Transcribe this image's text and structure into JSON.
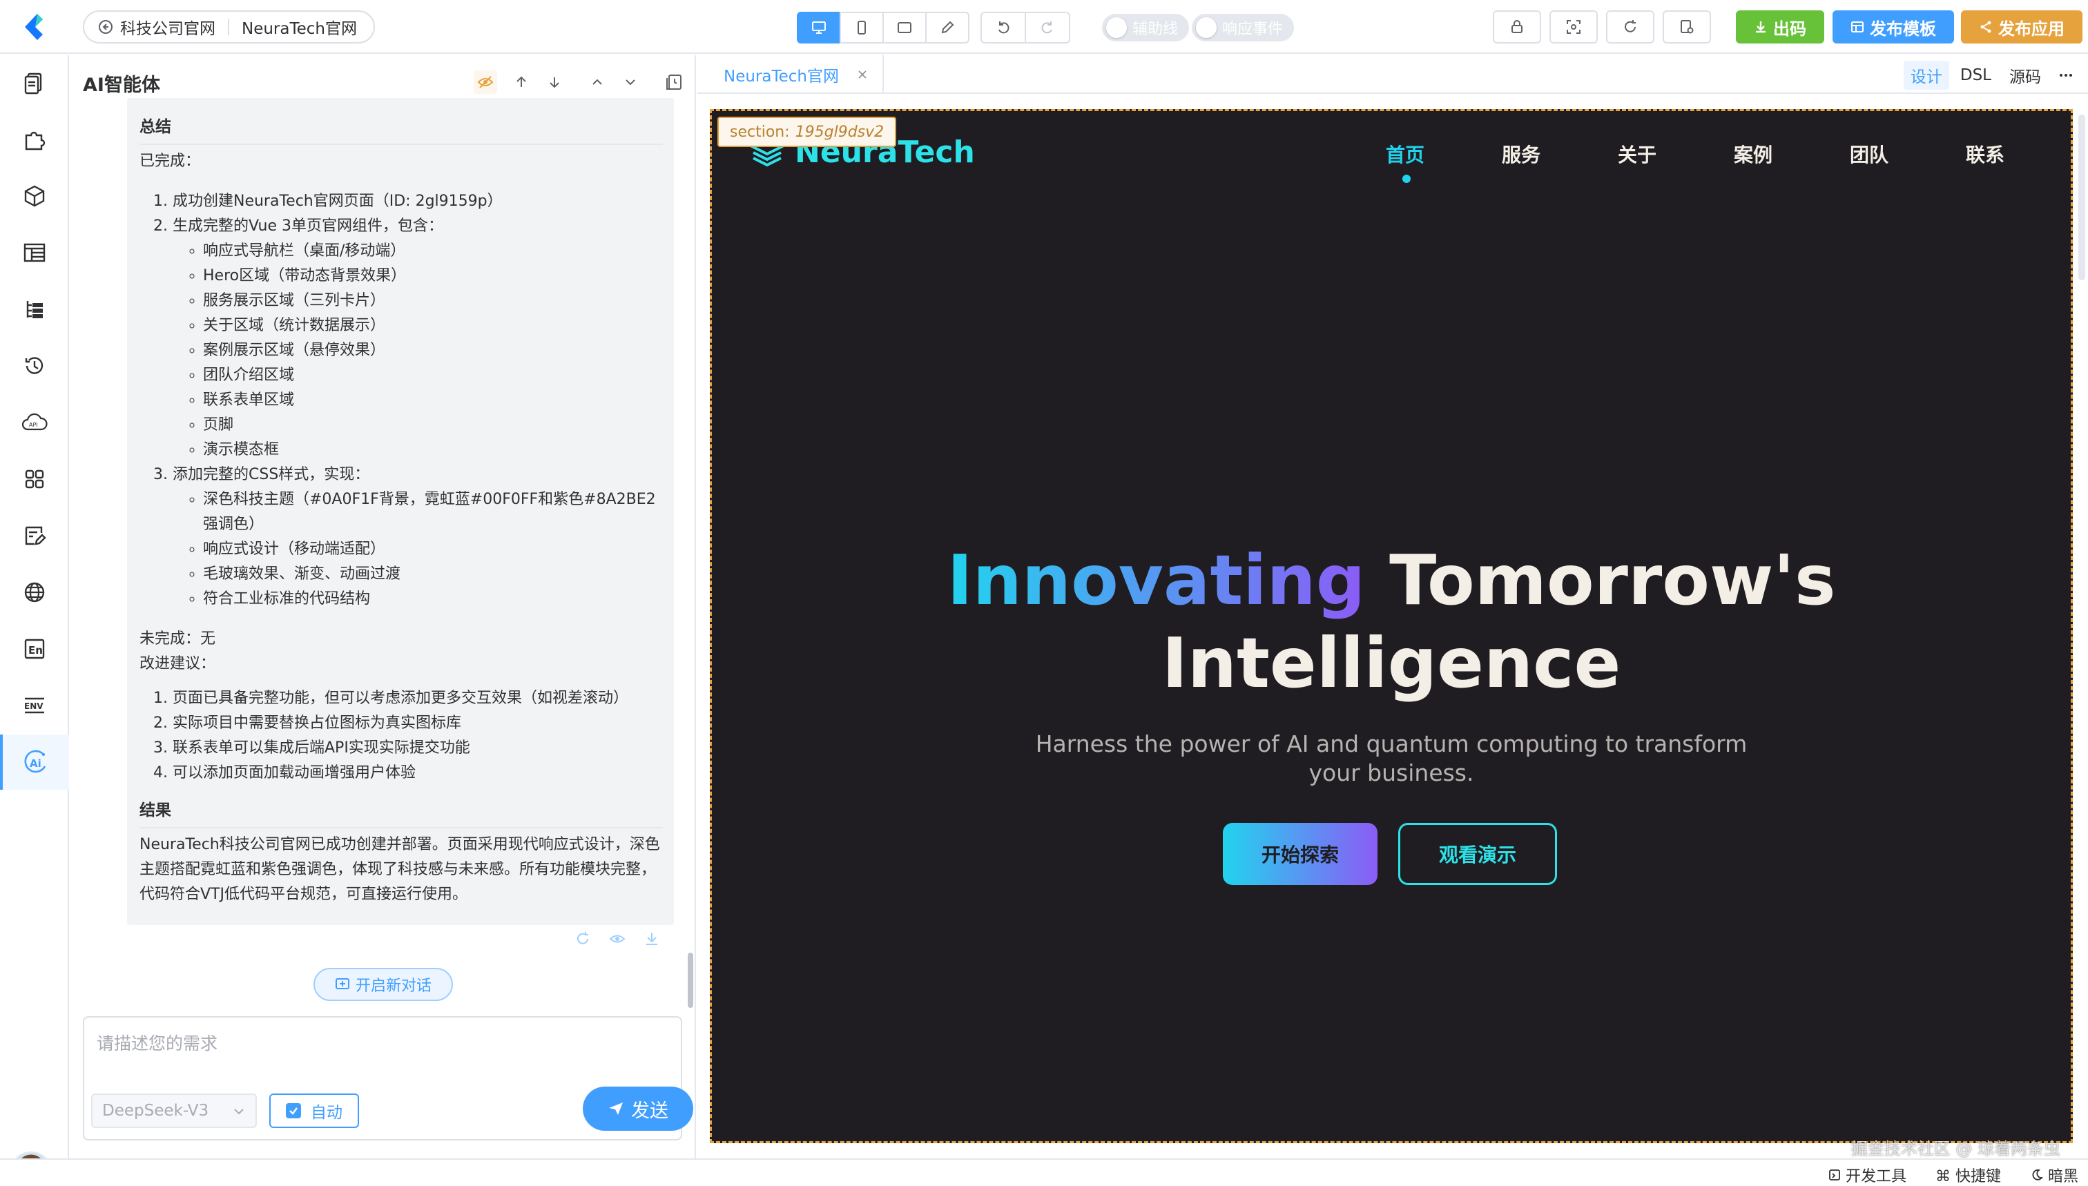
{
  "header": {
    "breadcrumb": {
      "project": "科技公司官网",
      "page": "NeuraTech官网"
    },
    "toggles": {
      "guides": "辅助线",
      "events": "响应事件"
    },
    "actions": {
      "export": "出码",
      "publish_template": "发布模板",
      "publish_app": "发布应用"
    },
    "colors": {
      "export": "#67c23a",
      "publish_template": "#409eff",
      "publish_app": "#e6a23c"
    }
  },
  "ai_panel": {
    "title": "AI智能体",
    "summary_heading": "总结",
    "done_label": "已完成：",
    "done_items": [
      "成功创建NeuraTech官网页面（ID: 2gl9159p）",
      "生成完整的Vue 3单页官网组件，包含：",
      "添加完整的CSS样式，实现："
    ],
    "component_list": [
      "响应式导航栏（桌面/移动端）",
      "Hero区域（带动态背景效果）",
      "服务展示区域（三列卡片）",
      "关于区域（统计数据展示）",
      "案例展示区域（悬停效果）",
      "团队介绍区域",
      "联系表单区域",
      "页脚",
      "演示模态框"
    ],
    "style_list": [
      "深色科技主题（#0A0F1F背景，霓虹蓝#00F0FF和紫色#8A2BE2强调色）",
      "响应式设计（移动端适配）",
      "毛玻璃效果、渐变、动画过渡",
      "符合工业标准的代码结构"
    ],
    "not_done": "未完成：无",
    "suggest_label": "改进建议：",
    "suggestions": [
      "页面已具备完整功能，但可以考虑添加更多交互效果（如视差滚动）",
      "实际项目中需要替换占位图标为真实图标库",
      "联系表单可以集成后端API实现实际提交功能",
      "可以添加页面加载动画增强用户体验"
    ],
    "result_heading": "结果",
    "result_text": "NeuraTech科技公司官网已成功创建并部署。页面采用现代响应式设计，深色主题搭配霓虹蓝和紫色强调色，体现了科技感与未来感。所有功能模块完整，代码符合VTJ低代码平台规范，可直接运行使用。",
    "new_chat": "开启新对话",
    "input_placeholder": "请描述您的需求",
    "model": "DeepSeek-V3",
    "auto_label": "自动",
    "auto_checked": true,
    "send_label": "发送"
  },
  "design": {
    "tab_label": "NeuraTech官网",
    "modes": [
      "设计",
      "DSL",
      "源码"
    ],
    "active_mode": "设计",
    "section_badge": {
      "prefix": "section:",
      "id": "195gl9dsv2"
    },
    "site": {
      "brand": "NeuraTech",
      "nav": [
        "首页",
        "服务",
        "关于",
        "案例",
        "团队",
        "联系"
      ],
      "active_nav": "首页",
      "hero_title_gradient": "Innovating",
      "hero_title_rest": " Tomorrow's",
      "hero_title_line2": "Intelligence",
      "hero_subtitle": "Harness the power of AI and quantum computing to transform your business.",
      "cta_primary": "开始探索",
      "cta_secondary": "观看演示",
      "colors": {
        "background": "#1f1d22",
        "accent": "#22d3ee",
        "purple": "#8b5cf6"
      }
    }
  },
  "footer": {
    "devtools": "开发工具",
    "shortcuts": "⌘ 快捷键",
    "theme": "暗黑",
    "watermark": "掘金技术社区 @ 琼着两条虫"
  }
}
